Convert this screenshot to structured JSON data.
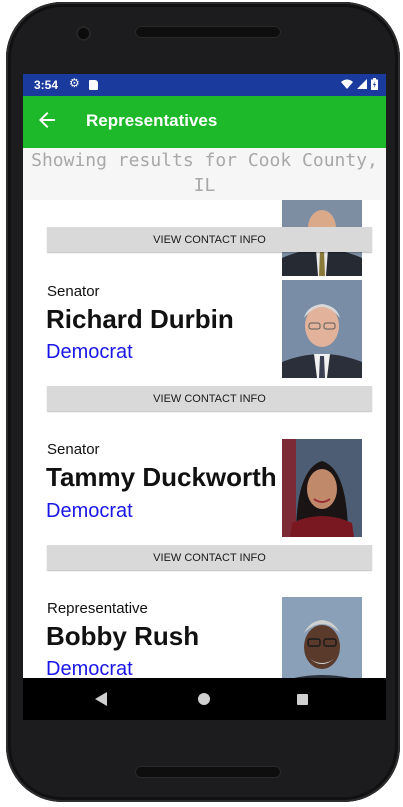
{
  "status_bar": {
    "time": "3:54",
    "icons": [
      "gear-icon",
      "sd-card-icon",
      "wifi-icon",
      "cell-signal-icon",
      "battery-icon"
    ]
  },
  "app_bar": {
    "back_icon": "arrow-left-icon",
    "title": "Representatives",
    "color": "#1db92a"
  },
  "location_header": {
    "text": "Showing results for Cook County, IL"
  },
  "representatives": [
    {
      "office": "",
      "name": "",
      "party": "",
      "button_label": "VIEW CONTACT INFO"
    },
    {
      "office": "Senator",
      "name": "Richard Durbin",
      "party": "Democrat",
      "button_label": "VIEW CONTACT INFO"
    },
    {
      "office": "Senator",
      "name": "Tammy Duckworth",
      "party": "Democrat",
      "button_label": "VIEW CONTACT INFO"
    },
    {
      "office": "Representative",
      "name": "Bobby Rush",
      "party": "Democrat"
    }
  ],
  "colors": {
    "status_bar": "#1a3a9e",
    "party_text": "#1a16e8",
    "button_bg": "#d9d9d9"
  },
  "nav_bar": {
    "icons": [
      "back-triangle-icon",
      "home-circle-icon",
      "recents-square-icon"
    ]
  }
}
